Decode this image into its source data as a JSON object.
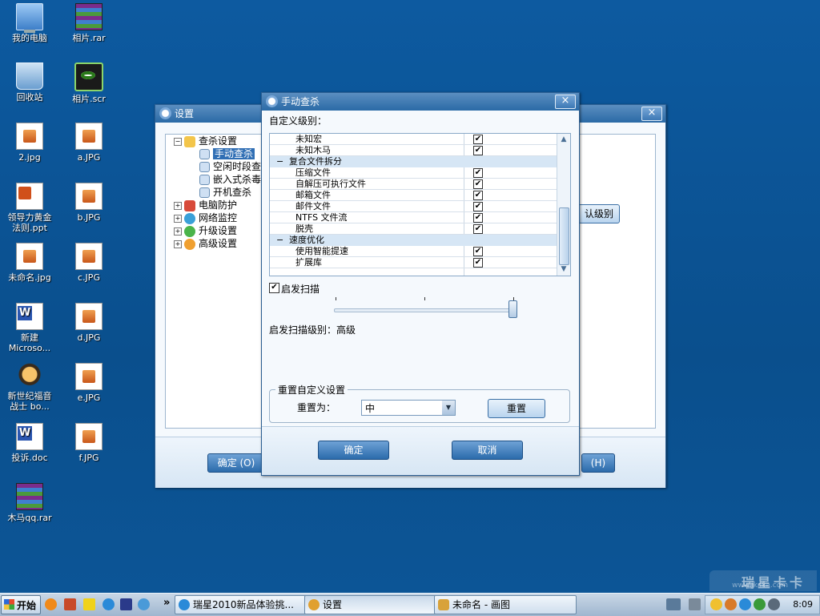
{
  "desktop_icons": [
    {
      "label": "我的电脑",
      "icon": "computer-icon"
    },
    {
      "label": "相片.rar",
      "icon": "winrar-archive-icon"
    },
    {
      "label": "回收站",
      "icon": "recycle-bin-icon"
    },
    {
      "label": "相片.scr",
      "icon": "screensaver-eye-icon"
    },
    {
      "label": "2.jpg",
      "icon": "image-file-icon"
    },
    {
      "label": "a.JPG",
      "icon": "image-file-icon"
    },
    {
      "label": "领导力黄金\n法则.ppt",
      "icon": "powerpoint-file-icon"
    },
    {
      "label": "b.JPG",
      "icon": "image-file-icon"
    },
    {
      "label": "未命名.jpg",
      "icon": "image-file-icon"
    },
    {
      "label": "c.JPG",
      "icon": "image-file-icon"
    },
    {
      "label": "新建\nMicroso...",
      "icon": "word-file-icon"
    },
    {
      "label": "d.JPG",
      "icon": "image-file-icon"
    },
    {
      "label": "新世纪福音\n战士 bo...",
      "icon": "music-file-icon"
    },
    {
      "label": "e.JPG",
      "icon": "image-file-icon"
    },
    {
      "label": "投诉.doc",
      "icon": "word-file-icon"
    },
    {
      "label": "f.JPG",
      "icon": "image-file-icon"
    },
    {
      "label": "木马qq.rar",
      "icon": "winrar-archive-icon"
    }
  ],
  "settings_window": {
    "title": "设置",
    "tree": [
      {
        "label": "查杀设置",
        "expander": "⊟"
      },
      {
        "label": "手动查杀"
      },
      {
        "label": "空闲时段查"
      },
      {
        "label": "嵌入式杀毒"
      },
      {
        "label": "开机查杀"
      },
      {
        "label": "电脑防护",
        "expander": "⊞"
      },
      {
        "label": "网络监控",
        "expander": "⊞"
      },
      {
        "label": "升级设置",
        "expander": "⊞"
      },
      {
        "label": "高级设置",
        "expander": "⊞"
      }
    ],
    "default_level_btn": "认级别",
    "ok_btn": "确定 (O)",
    "help_btn": "(H)"
  },
  "dialog": {
    "title": "手动查杀",
    "custom_level_label": "自定义级别：",
    "rows": [
      {
        "type": "item",
        "label": "未知宏",
        "checked": true
      },
      {
        "type": "item",
        "label": "未知木马",
        "checked": true
      },
      {
        "type": "group",
        "label": "复合文件拆分"
      },
      {
        "type": "item",
        "label": "压缩文件",
        "checked": true
      },
      {
        "type": "item",
        "label": "自解压可执行文件",
        "checked": true
      },
      {
        "type": "item",
        "label": "邮箱文件",
        "checked": true
      },
      {
        "type": "item",
        "label": "邮件文件",
        "checked": true
      },
      {
        "type": "item",
        "label": "NTFS 文件流",
        "checked": true
      },
      {
        "type": "item",
        "label": "脱壳",
        "checked": true
      },
      {
        "type": "group",
        "label": "速度优化"
      },
      {
        "type": "item",
        "label": "使用智能提速",
        "checked": true
      },
      {
        "type": "item",
        "label": "扩展库",
        "checked": true
      }
    ],
    "heuristic_label": "启发扫描",
    "heuristic_checked": true,
    "heuristic_level_percent": 100,
    "heuristic_level_text": "启发扫描级别：高级",
    "reset_group_title": "重置自定义设置",
    "reset_to_label": "重置为：",
    "reset_select_value": "中",
    "reset_btn": "重置",
    "ok_btn": "确定",
    "cancel_btn": "取消"
  },
  "taskbar": {
    "start_label": "开始",
    "overflow": "»",
    "tasks": [
      {
        "label": "瑞星2010新品体验挑...",
        "icon": "ie-icon"
      },
      {
        "label": "设置",
        "icon": "rising-icon"
      },
      {
        "label": "未命名 - 画图",
        "icon": "paint-icon"
      }
    ],
    "clock": "8:09"
  },
  "watermark": {
    "title": "瑞星卡卡",
    "url": "www.ikaka.com"
  },
  "colors": {
    "accent": "#2b6bab",
    "desktop": "#0b4f8c",
    "selection": "#2f6eb4"
  }
}
